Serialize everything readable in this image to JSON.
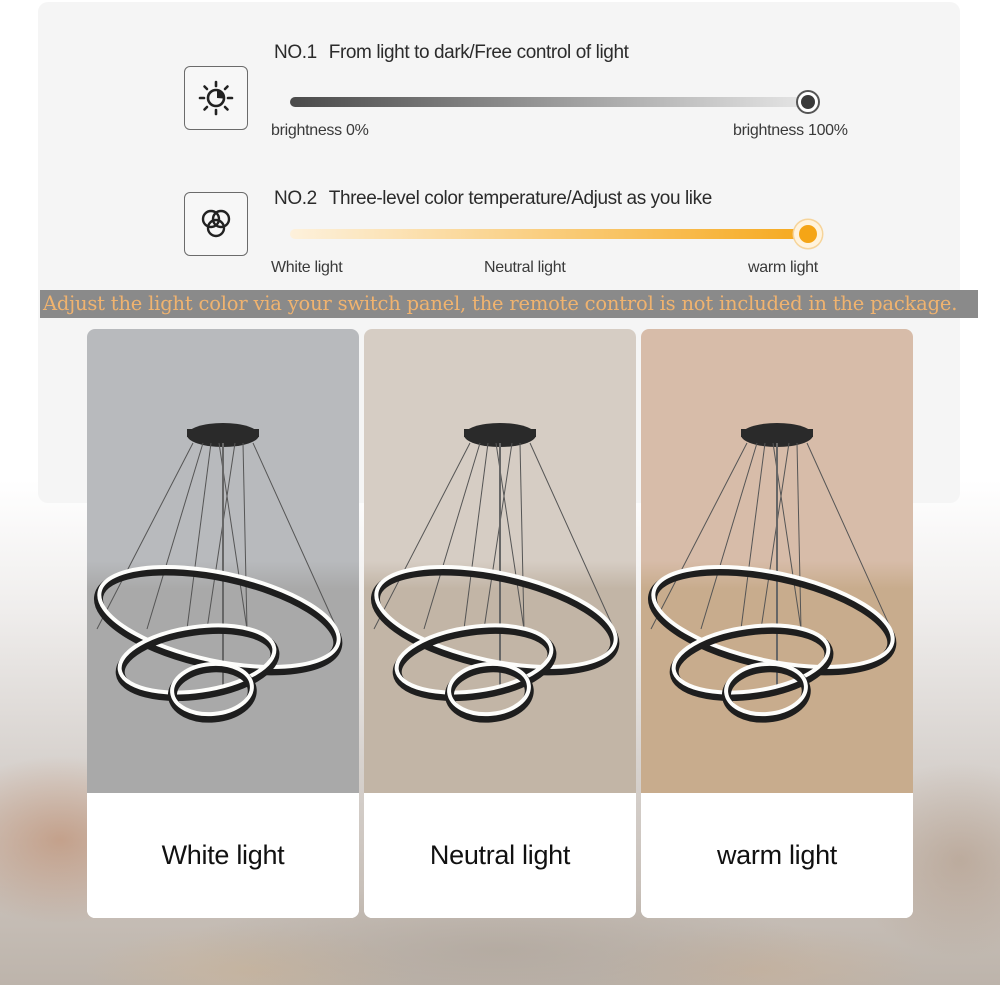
{
  "features": [
    {
      "number": "NO.1",
      "title": "From light to dark/Free control of light",
      "icon": "brightness-icon",
      "slider": {
        "kind": "brightness",
        "value_percent": 100,
        "labels": [
          "brightness 0%",
          "brightness 100%"
        ],
        "gradient": [
          "#4a4a4a",
          "#e6e6e6"
        ],
        "knob_color": "#3a3a3a"
      }
    },
    {
      "number": "NO.2",
      "title": "Three-level color temperature/Adjust as you like",
      "icon": "color-temperature-icon",
      "slider": {
        "kind": "color-temperature",
        "value_percent": 100,
        "labels": [
          "White light",
          "Neutral light",
          "warm light"
        ],
        "gradient": [
          "#fdf1dc",
          "#f6a91e"
        ],
        "knob_color": "#f5a516"
      }
    }
  ],
  "notice": "Adjust the light color via your switch panel, the remote control is not included in the package.",
  "cards": [
    {
      "label": "White light",
      "scene": "white",
      "ceiling": "#b8babd",
      "wall": "#a9a9a9"
    },
    {
      "label": "Neutral light",
      "scene": "neutral",
      "ceiling": "#d6cdc4",
      "wall": "#c2b5a6"
    },
    {
      "label": "warm light",
      "scene": "warm",
      "ceiling": "#d7bca9",
      "wall": "#c8ac8d"
    }
  ]
}
